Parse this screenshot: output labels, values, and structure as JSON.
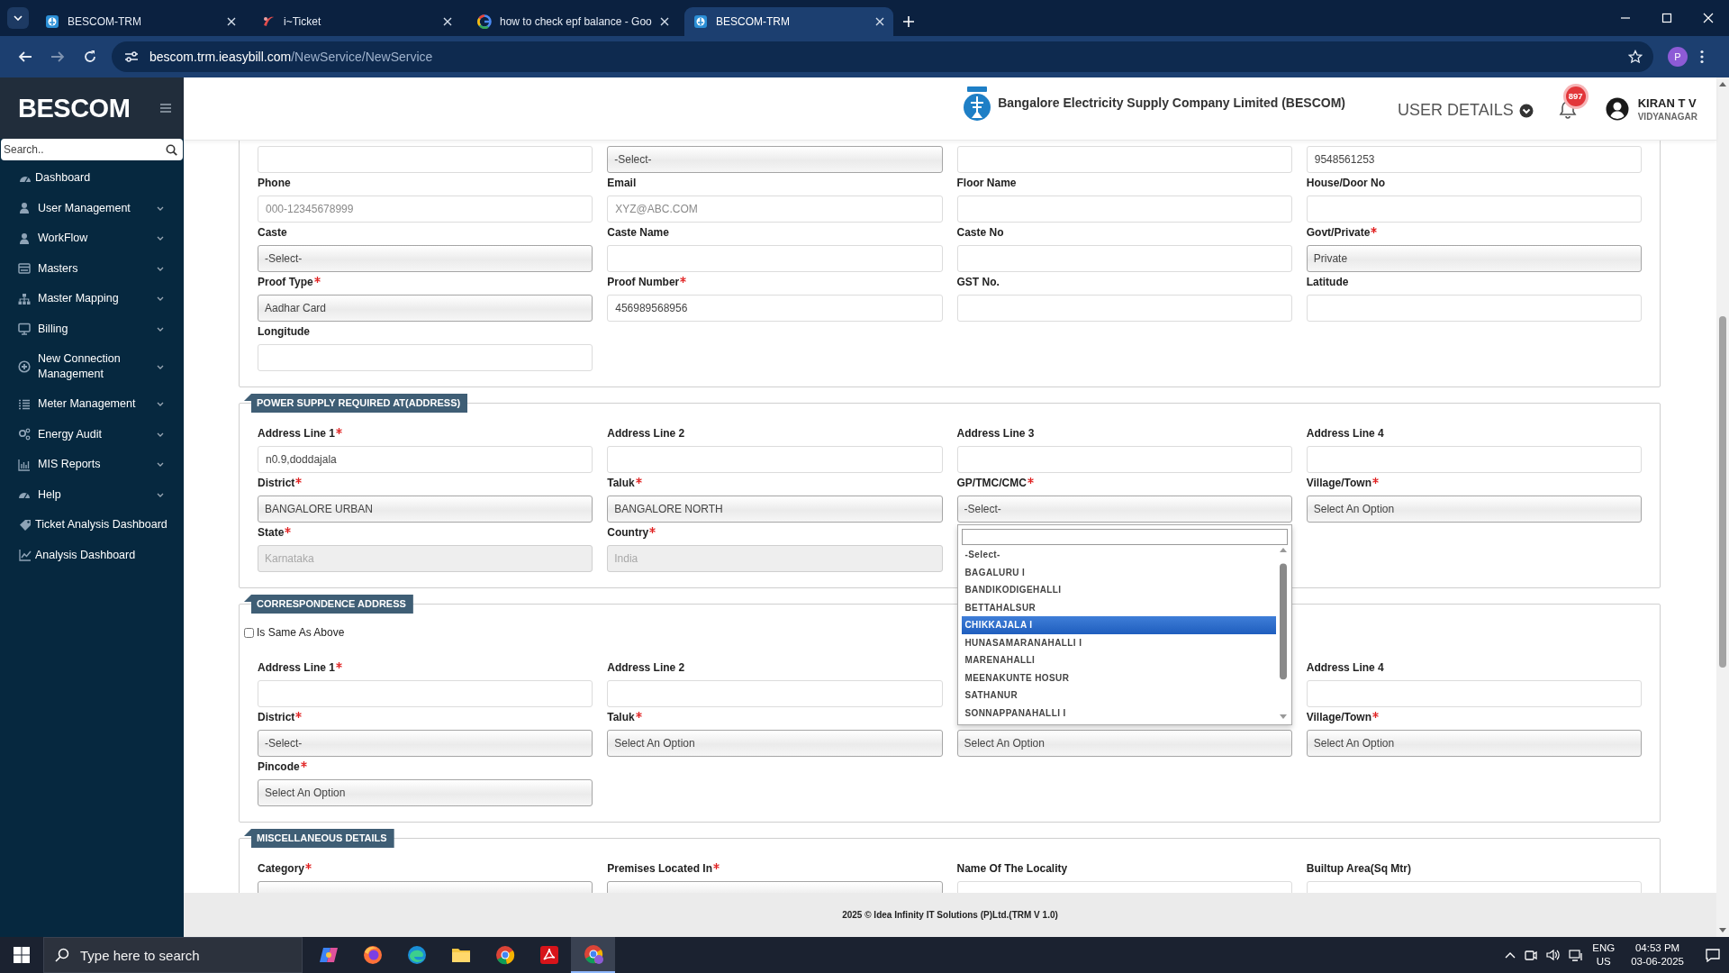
{
  "browser": {
    "tabs": [
      {
        "title": "BESCOM-TRM",
        "selected": false
      },
      {
        "title": "i~Ticket",
        "selected": false
      },
      {
        "title": "how to check epf balance - Goo",
        "selected": false
      },
      {
        "title": "BESCOM-TRM",
        "selected": true
      }
    ],
    "url": {
      "host": "bescom.trm.ieasybill.com",
      "path": "/NewService/NewService"
    },
    "profile": "P"
  },
  "sidebar": {
    "brand": "BESCOM",
    "search_placeholder": "Search..",
    "items": [
      {
        "label": "Dashboard",
        "has_submenu": false
      },
      {
        "label": "User Management",
        "has_submenu": true
      },
      {
        "label": "WorkFlow",
        "has_submenu": true
      },
      {
        "label": "Masters",
        "has_submenu": true
      },
      {
        "label": "Master Mapping",
        "has_submenu": true
      },
      {
        "label": "Billing",
        "has_submenu": true
      },
      {
        "label": "New Connection Management",
        "has_submenu": true
      },
      {
        "label": "Meter Management",
        "has_submenu": true
      },
      {
        "label": "Energy Audit",
        "has_submenu": true
      },
      {
        "label": "MIS Reports",
        "has_submenu": true
      },
      {
        "label": "Help",
        "has_submenu": true
      },
      {
        "label": "Ticket Analysis Dashboard",
        "has_submenu": false
      },
      {
        "label": "Analysis Dashboard",
        "has_submenu": false
      }
    ]
  },
  "header": {
    "company": "Bangalore Electricity Supply Company Limited (BESCOM)",
    "user_menu": "USER DETAILS",
    "notification_count": "897",
    "user_name": "KIRAN T V",
    "user_location": "VIDYANAGAR"
  },
  "sections": [
    {
      "fields": [
        {
          "kind": "text",
          "required": false,
          "disabled": false
        },
        {
          "kind": "select",
          "value": "-Select-",
          "required": false,
          "disabled": false
        },
        {
          "kind": "text",
          "required": false,
          "disabled": false
        },
        {
          "kind": "text",
          "value": "9548561253",
          "required": false,
          "disabled": false
        },
        {
          "label": "Phone",
          "kind": "text",
          "placeholder": "000-12345678999",
          "required": false,
          "disabled": false
        },
        {
          "label": "Email",
          "kind": "text",
          "placeholder": "XYZ@ABC.COM",
          "required": false,
          "disabled": false
        },
        {
          "label": "Floor Name",
          "kind": "text",
          "required": false,
          "disabled": false
        },
        {
          "label": "House/Door No",
          "kind": "text",
          "required": false,
          "disabled": false
        },
        {
          "label": "Caste",
          "kind": "select",
          "value": "-Select-",
          "required": false,
          "disabled": false
        },
        {
          "label": "Caste Name",
          "kind": "text",
          "required": false,
          "disabled": false
        },
        {
          "label": "Caste No",
          "kind": "text",
          "required": false,
          "disabled": false
        },
        {
          "label": "Govt/Private",
          "kind": "select",
          "value": "Private",
          "required": true,
          "disabled": false
        },
        {
          "label": "Proof Type",
          "kind": "select",
          "value": "Aadhar Card",
          "required": true,
          "disabled": false
        },
        {
          "label": "Proof Number",
          "kind": "text",
          "value": "456989568956",
          "required": true,
          "disabled": false
        },
        {
          "label": "GST No.",
          "kind": "text",
          "required": false,
          "disabled": false
        },
        {
          "label": "Latitude",
          "kind": "text",
          "required": false,
          "disabled": false
        },
        {
          "label": "Longitude",
          "kind": "text",
          "required": false,
          "disabled": false
        }
      ]
    },
    {
      "title": "POWER SUPPLY REQUIRED AT(ADDRESS)",
      "fields": [
        {
          "label": "Address Line 1",
          "kind": "text",
          "value": "n0.9,doddajala",
          "required": true,
          "disabled": false
        },
        {
          "label": "Address Line 2",
          "kind": "text",
          "required": false,
          "disabled": false
        },
        {
          "label": "Address Line 3",
          "kind": "text",
          "required": false,
          "disabled": false
        },
        {
          "label": "Address Line 4",
          "kind": "text",
          "required": false,
          "disabled": false
        },
        {
          "label": "District",
          "kind": "select",
          "value": "BANGALORE URBAN",
          "required": true,
          "disabled": false
        },
        {
          "label": "Taluk",
          "kind": "select",
          "value": "BANGALORE NORTH",
          "required": true,
          "disabled": false
        },
        {
          "label": "GP/TMC/CMC",
          "kind": "select",
          "value": "-Select-",
          "required": true,
          "disabled": false,
          "dropdown": {
            "options": [
              {
                "label": "-Select-",
                "selected": false
              },
              {
                "label": "BAGALURU I",
                "selected": false
              },
              {
                "label": "BANDIKODIGEHALLI",
                "selected": false
              },
              {
                "label": "BETTAHALSUR",
                "selected": false
              },
              {
                "label": "CHIKKAJALA I",
                "selected": true
              },
              {
                "label": "HUNASAMARANAHALLI I",
                "selected": false
              },
              {
                "label": "MARENAHALLI",
                "selected": false
              },
              {
                "label": "MEENAKUNTE HOSUR",
                "selected": false
              },
              {
                "label": "SATHANUR",
                "selected": false
              },
              {
                "label": "SONNAPPANAHALLI I",
                "selected": false
              }
            ]
          }
        },
        {
          "label": "Village/Town",
          "kind": "select",
          "value": "Select An Option",
          "required": true,
          "disabled": false
        },
        {
          "label": "State",
          "kind": "select",
          "value": "Karnataka",
          "required": true,
          "disabled": true
        },
        {
          "label": "Country",
          "kind": "select",
          "value": "India",
          "required": true,
          "disabled": true
        }
      ]
    },
    {
      "title": "CORRESPONDENCE ADDRESS",
      "checkbox": {
        "label": "Is Same As Above",
        "checked": false
      },
      "fields": [
        {
          "label": "Address Line 1",
          "kind": "text",
          "required": true,
          "disabled": false
        },
        {
          "label": "Address Line 2",
          "kind": "text",
          "required": false,
          "disabled": false
        },
        {
          "label": "Address Line 4",
          "kind": "text",
          "required": false,
          "disabled": false
        },
        {
          "label": "District",
          "kind": "select",
          "value": "-Select-",
          "required": true,
          "disabled": false
        },
        {
          "label": "Taluk",
          "kind": "select",
          "value": "Select An Option",
          "required": true,
          "disabled": false
        },
        {
          "kind": "select",
          "value": "Select An Option",
          "required": false,
          "disabled": false
        },
        {
          "label": "Village/Town",
          "kind": "select",
          "value": "Select An Option",
          "required": true,
          "disabled": false
        },
        {
          "label": "Pincode",
          "kind": "select",
          "value": "Select An Option",
          "required": true,
          "disabled": false
        }
      ]
    },
    {
      "title": "MISCELLANEOUS DETAILS",
      "fields": [
        {
          "label": "Category",
          "kind": "select",
          "required": true,
          "disabled": false
        },
        {
          "label": "Premises Located In",
          "kind": "select",
          "required": true,
          "disabled": false
        },
        {
          "label": "Name Of The Locality",
          "kind": "text",
          "required": false,
          "disabled": false
        },
        {
          "label": "Builtup Area(Sq Mtr)",
          "kind": "text",
          "required": false,
          "disabled": false
        }
      ]
    }
  ],
  "footer": "2025 © Idea Infinity IT Solutions (P)Ltd.(TRM V 1.0)",
  "taskbar": {
    "search_placeholder": "Type here to search",
    "apps": [
      {
        "active": false
      },
      {
        "active": false
      },
      {
        "active": false
      },
      {
        "active": false
      },
      {
        "active": false
      },
      {
        "active": false
      },
      {
        "active": true
      }
    ],
    "language": "ENG",
    "region": "US",
    "time": "04:53 PM",
    "date": "03-06-2025"
  }
}
